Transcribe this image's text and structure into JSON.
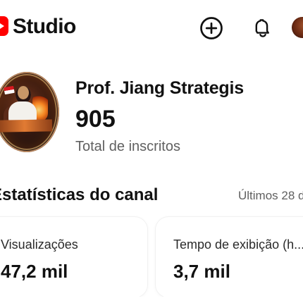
{
  "app": {
    "brand_label": "Studio"
  },
  "header": {
    "actions": [
      {
        "name": "create",
        "icon": "plus-circle-icon"
      },
      {
        "name": "notifications",
        "icon": "bell-icon"
      },
      {
        "name": "profile",
        "icon": "avatar-icon"
      }
    ]
  },
  "channel": {
    "name": "Prof. Jiang Strategis",
    "subscriber_count": "905",
    "subscriber_label": "Total de inscritos"
  },
  "analytics": {
    "section_title": "Estatísticas do canal",
    "period_label": "Últimos 28 d",
    "cards": [
      {
        "label": "Visualizações",
        "value": "47,2 mil"
      },
      {
        "label": "Tempo de exibição (h...",
        "value": "3,7 mil"
      }
    ]
  },
  "colors": {
    "brand_red": "#ff0000",
    "text_primary": "#111111",
    "text_secondary": "#606060",
    "card_border": "#f1f1f1"
  }
}
